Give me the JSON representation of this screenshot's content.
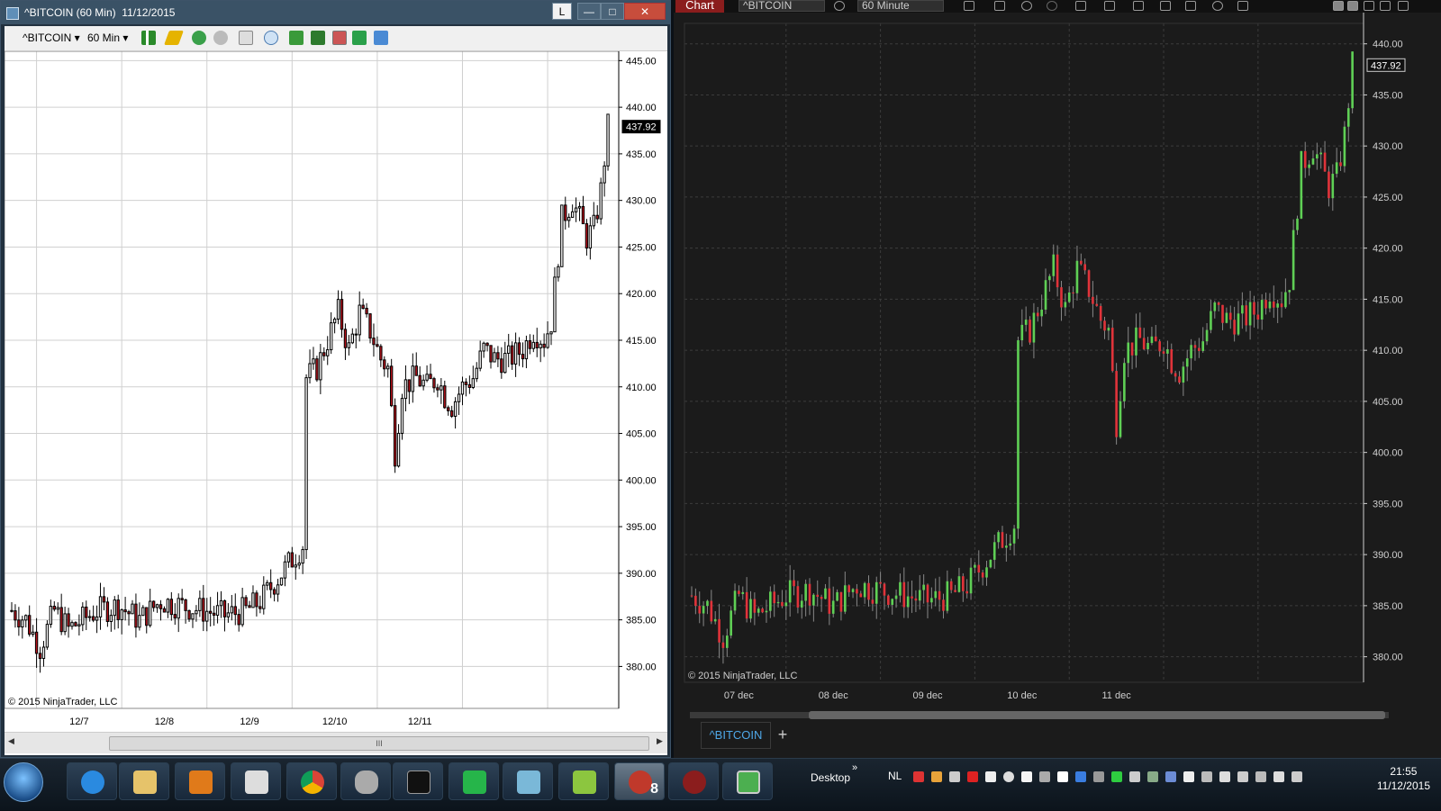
{
  "left_window": {
    "title": "^BITCOIN (60 Min)  11/12/2015",
    "buttons": {
      "L": "L",
      "min": "—",
      "max": "□",
      "close": "✕"
    },
    "toolbar": {
      "instrument": "^BITCOIN ▾",
      "interval": "60 Min ▾"
    },
    "copyright": "© 2015 NinjaTrader, LLC",
    "last_price": "437.92",
    "scroll_grip": "III"
  },
  "right_window": {
    "title_label": "Chart",
    "instrument_select": "^BITCOIN",
    "interval_select": "60 Minute",
    "copyright": "© 2015 NinjaTrader, LLC",
    "last_price": "437.92",
    "tab_label": "^BITCOIN",
    "add_tab": "+"
  },
  "chart_data": [
    {
      "type": "candlestick",
      "title": "^BITCOIN (60 Min)",
      "x_labels": [
        "12/7",
        "12/8",
        "12/9",
        "12/10",
        "12/11"
      ],
      "y_ticks": [
        380,
        385,
        390,
        395,
        400,
        405,
        410,
        415,
        420,
        425,
        430,
        435,
        440,
        445
      ],
      "ylim": [
        375.5,
        446
      ],
      "last": 437.92,
      "ohlc": []
    },
    {
      "type": "candlestick",
      "title": "^BITCOIN 60 Minute",
      "x_labels": [
        "07 dec",
        "08 dec",
        "09 dec",
        "10 dec",
        "11 dec"
      ],
      "y_ticks": [
        380,
        385,
        390,
        395,
        400,
        405,
        410,
        415,
        420,
        425,
        430,
        435,
        440
      ],
      "ylim": [
        377.5,
        442
      ],
      "last": 437.92,
      "ohlc": []
    }
  ],
  "taskbar": {
    "desktop_label": "Desktop",
    "arrows": "»",
    "lang": "NL",
    "time": "21:55",
    "date": "11/12/2015",
    "badge": "8"
  },
  "colors": {
    "up_light": "#ffffff",
    "up_light_border": "#000000",
    "down_light": "#b5121b",
    "up_dark": "#5fcf55",
    "down_dark": "#e0333a",
    "accent": "#8b1d1d"
  }
}
